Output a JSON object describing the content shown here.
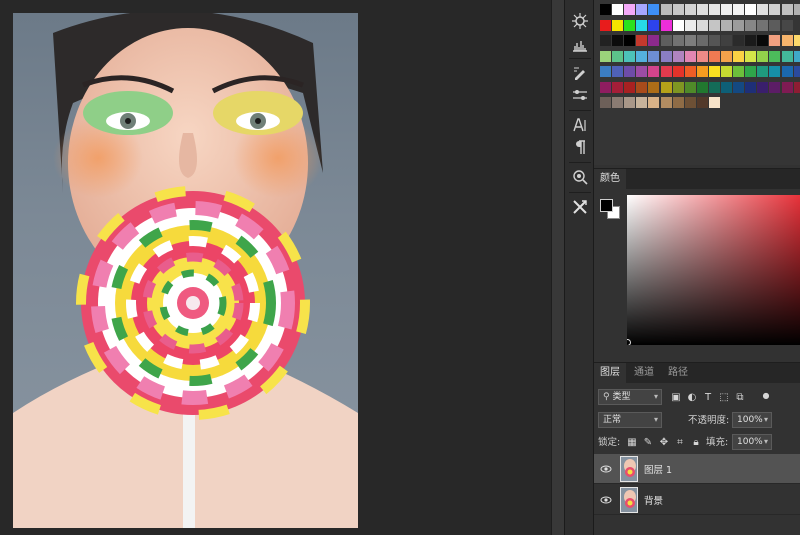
{
  "swatch_rows": [
    [
      "#000000",
      "#ffffff",
      "#f4a9f8",
      "#a7a7ff",
      "#3e8ff5",
      "#bcbcbc",
      "#c8c8c8",
      "#d3d3d3",
      "#dedede",
      "#e5e5e5",
      "#eeeeee",
      "#f3f3f3",
      "#ffffff",
      "#e0e0e0",
      "#d0d0d0",
      "#c0c0c0",
      "#b0b0b0"
    ],
    [
      "#e81c1c",
      "#f5e400",
      "#2be21d",
      "#27d9e7",
      "#2d43ec",
      "#ee2ed9",
      "#ffffff",
      "#ebebeb",
      "#d9d9d9",
      "#c5c5c5",
      "#b1b1b1",
      "#9c9c9c",
      "#878787",
      "#737373",
      "#5c5c5c",
      "#474747",
      "#353535"
    ],
    [
      "#222222",
      "#0c0c0c",
      "#000000",
      "#c4392d",
      "#8c2a8c",
      "#5e5e5e",
      "#727272",
      "#7d7d7d",
      "#6a6a6a",
      "#555555",
      "#404040",
      "#2b2b2b",
      "#1a1a1a",
      "#090909",
      "#f2a080",
      "#f6b46c",
      "#fcd86a"
    ],
    [
      "#9bd37b",
      "#5cc38a",
      "#4cc2b9",
      "#54b1de",
      "#6e8fd3",
      "#8a7ec3",
      "#b084c0",
      "#e186b3",
      "#ee8a87",
      "#ef7a52",
      "#f3a24b",
      "#fbd244",
      "#d4e549",
      "#93d24b",
      "#4cbc5b",
      "#43b79a",
      "#3fa9c9"
    ],
    [
      "#3b7dc2",
      "#4f61b8",
      "#6e4ca8",
      "#9c4ca5",
      "#d3448c",
      "#e33a4d",
      "#e4332a",
      "#ee5d26",
      "#f49b20",
      "#fbe021",
      "#c5d931",
      "#6cbf3b",
      "#2fa64a",
      "#1f9a7e",
      "#168fa8",
      "#1b68ad",
      "#2b4a9d"
    ],
    [
      "#8f1d60",
      "#a51e38",
      "#a82121",
      "#a84b1b",
      "#ac6d17",
      "#b6a219",
      "#7f9622",
      "#4f8a29",
      "#21782f",
      "#146b58",
      "#0e5f77",
      "#144982",
      "#1e2f78",
      "#3a1f6c",
      "#5c1d66",
      "#7f1b53",
      "#8e1d33"
    ],
    [
      "#6d6059",
      "#8a7b72",
      "#a99788",
      "#c7b39b",
      "#d8b287",
      "#b28c61",
      "#8f6c46",
      "#6d5035",
      "#52392a",
      "#f7e3c9"
    ]
  ],
  "strip_icons": [
    "navigator-icon",
    "histogram-icon",
    "brush-settings-icon",
    "adjust-icon",
    "character-icon",
    "paragraph-icon",
    "properties-icon",
    "tools-icon"
  ],
  "color_panel": {
    "tab": "颜色",
    "fg": "#000000",
    "bg": "#ffffff",
    "hue": "#e8323a"
  },
  "layers_panel": {
    "tabs": [
      "图层",
      "通道",
      "路径"
    ],
    "filter_kind": "类型",
    "blend_mode": "正常",
    "opacity_label": "不透明度:",
    "opacity_value": "100%",
    "lock_label": "锁定:",
    "fill_label": "填充:",
    "fill_value": "100%",
    "layers": [
      {
        "name": "图层 1",
        "selected": true
      },
      {
        "name": "背景",
        "selected": false
      }
    ]
  }
}
